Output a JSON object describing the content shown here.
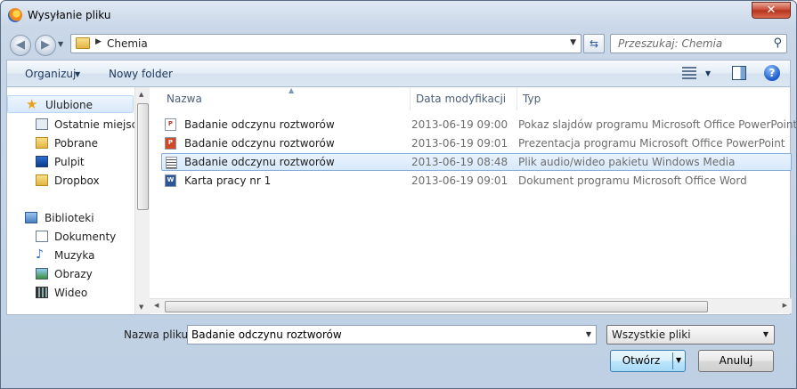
{
  "window": {
    "title": "Wysyłanie pliku",
    "close_label": "✕"
  },
  "address": {
    "path": "Chemia",
    "search_placeholder": "Przeszukaj: Chemia"
  },
  "toolbar": {
    "organize_label": "Organizuj",
    "new_folder_label": "Nowy folder"
  },
  "nav": {
    "favorites_label": "Ulubione",
    "favorites": [
      {
        "label": "Ostatnie miejsca",
        "icon": "recent-places-icon"
      },
      {
        "label": "Pobrane",
        "icon": "downloads-folder-icon"
      },
      {
        "label": "Pulpit",
        "icon": "desktop-icon"
      },
      {
        "label": "Dropbox",
        "icon": "dropbox-folder-icon"
      }
    ],
    "libraries_label": "Biblioteki",
    "libraries": [
      {
        "label": "Dokumenty",
        "icon": "documents-icon"
      },
      {
        "label": "Muzyka",
        "icon": "music-icon"
      },
      {
        "label": "Obrazy",
        "icon": "pictures-icon"
      },
      {
        "label": "Wideo",
        "icon": "video-icon"
      }
    ]
  },
  "columns": {
    "name": "Nazwa",
    "date": "Data modyfikacji",
    "type": "Typ"
  },
  "files": [
    {
      "name": "Badanie odczynu roztworów",
      "date": "2013-06-19 09:00",
      "type": "Pokaz slajdów programu Microsoft Office PowerPoint",
      "icon": "powerpoint-show-icon",
      "selected": false
    },
    {
      "name": "Badanie odczynu roztworów",
      "date": "2013-06-19 09:01",
      "type": "Prezentacja programu Microsoft Office PowerPoint",
      "icon": "powerpoint-presentation-icon",
      "selected": false
    },
    {
      "name": "Badanie odczynu roztworów",
      "date": "2013-06-19 08:48",
      "type": "Plik audio/wideo pakietu Windows Media",
      "icon": "media-file-icon",
      "selected": true
    },
    {
      "name": "Karta pracy nr 1",
      "date": "2013-06-19 09:01",
      "type": "Dokument programu Microsoft Office Word",
      "icon": "word-document-icon",
      "selected": false
    }
  ],
  "footer": {
    "filename_label": "Nazwa pliku:",
    "filename_value": "Badanie odczynu roztworów",
    "filter_value": "Wszystkie pliki",
    "open_label": "Otwórz",
    "cancel_label": "Anuluj"
  }
}
